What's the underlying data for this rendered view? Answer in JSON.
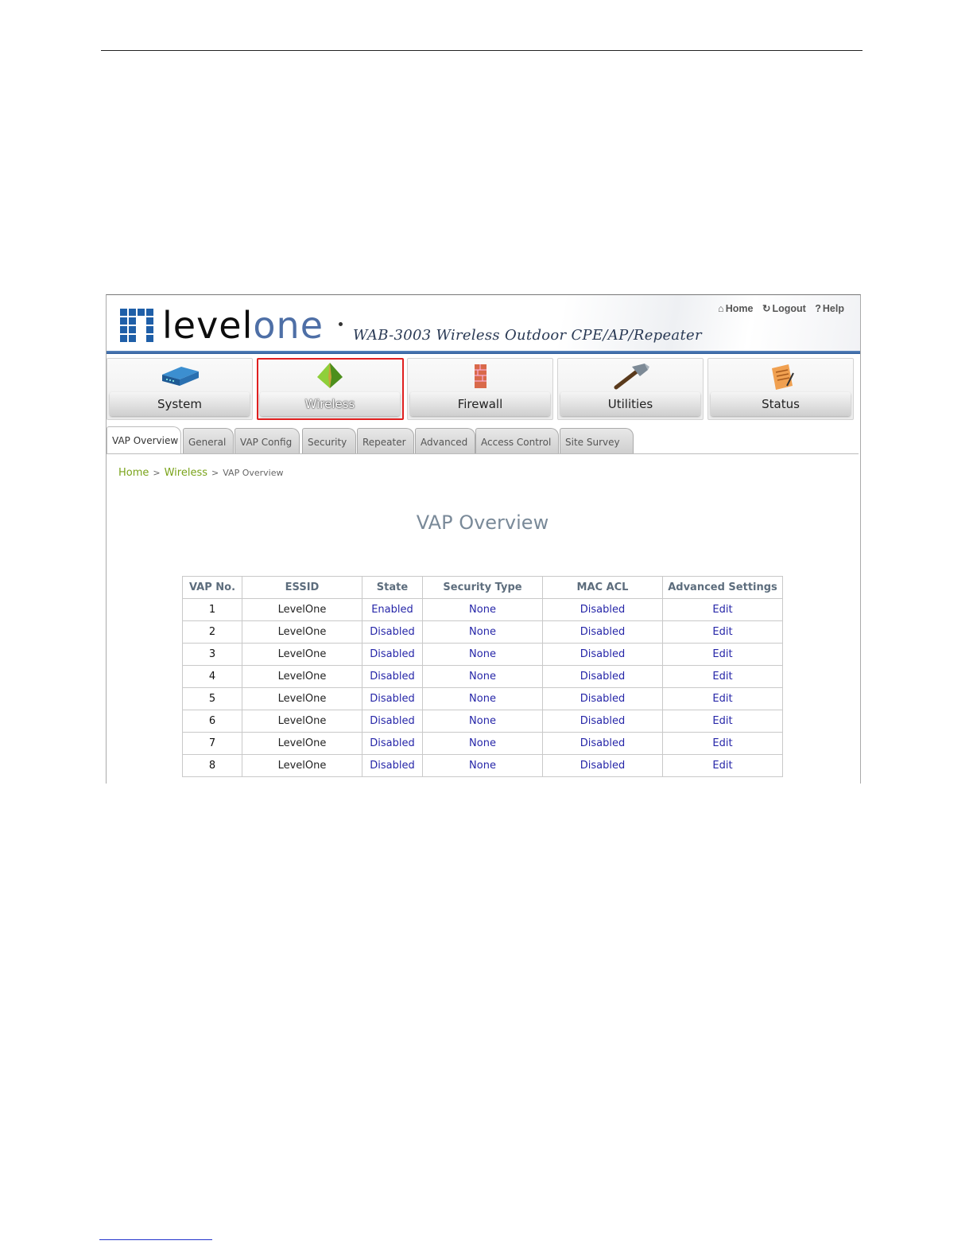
{
  "top_links": {
    "home": "Home",
    "logout": "Logout",
    "help": "Help"
  },
  "brand": {
    "logo_level": "level",
    "logo_one": "one",
    "product_title": "WAB-3003 Wireless Outdoor CPE/AP/Repeater"
  },
  "nav": {
    "items": [
      {
        "label": "System",
        "icon": "router-icon"
      },
      {
        "label": "Wireless",
        "icon": "antenna-icon",
        "active": true
      },
      {
        "label": "Firewall",
        "icon": "firewall-icon"
      },
      {
        "label": "Utilities",
        "icon": "hammer-icon"
      },
      {
        "label": "Status",
        "icon": "notepad-icon"
      }
    ],
    "highlight_color": "#e02020"
  },
  "subtabs": [
    {
      "label": "VAP Overview",
      "active": true
    },
    {
      "label": "General"
    },
    {
      "label": "VAP Config"
    },
    {
      "label": "Security"
    },
    {
      "label": "Repeater"
    },
    {
      "label": "Advanced"
    },
    {
      "label": "Access Control"
    },
    {
      "label": "Site Survey"
    }
  ],
  "breadcrumb": {
    "home": "Home",
    "section": "Wireless",
    "current": "VAP Overview",
    "sep": ">"
  },
  "page_title": "VAP Overview",
  "table": {
    "headers": [
      "VAP No.",
      "ESSID",
      "State",
      "Security Type",
      "MAC ACL",
      "Advanced Settings"
    ],
    "rows": [
      [
        "1",
        "LevelOne",
        "Enabled",
        "None",
        "Disabled",
        "Edit"
      ],
      [
        "2",
        "LevelOne",
        "Disabled",
        "None",
        "Disabled",
        "Edit"
      ],
      [
        "3",
        "LevelOne",
        "Disabled",
        "None",
        "Disabled",
        "Edit"
      ],
      [
        "4",
        "LevelOne",
        "Disabled",
        "None",
        "Disabled",
        "Edit"
      ],
      [
        "5",
        "LevelOne",
        "Disabled",
        "None",
        "Disabled",
        "Edit"
      ],
      [
        "6",
        "LevelOne",
        "Disabled",
        "None",
        "Disabled",
        "Edit"
      ],
      [
        "7",
        "LevelOne",
        "Disabled",
        "None",
        "Disabled",
        "Edit"
      ],
      [
        "8",
        "LevelOne",
        "Disabled",
        "None",
        "Disabled",
        "Edit"
      ]
    ]
  },
  "colors": {
    "link_green": "#7aa31a",
    "value_blue": "#2626a8",
    "header_bar": "#2e5d9b"
  }
}
